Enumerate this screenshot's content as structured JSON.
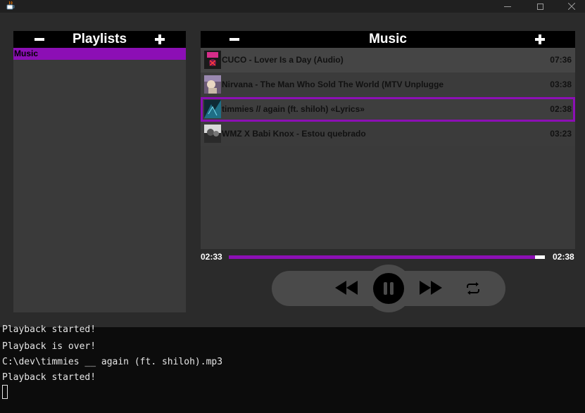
{
  "playlists": {
    "title": "Playlists",
    "items": [
      {
        "label": "Music",
        "selected": true
      }
    ]
  },
  "music": {
    "title": "Music",
    "tracks": [
      {
        "title": "CUCO - Lover Is a Day (Audio)",
        "duration": "07:36"
      },
      {
        "title": "Nirvana - The Man Who Sold The World (MTV Unplugge",
        "duration": "03:38"
      },
      {
        "title": "timmies // again (ft. shiloh) «Lyrics»",
        "duration": "02:38",
        "selected": true
      },
      {
        "title": "WMZ X Babi Knox - Estou quebrado",
        "duration": "03:23"
      }
    ]
  },
  "player": {
    "current_time": "02:33",
    "total_time": "02:38",
    "progress": 0.968
  },
  "console": {
    "lines": [
      "Playback started!",
      "Playback is over!",
      "C:\\dev\\timmies __ again (ft. shiloh).mp3",
      "Playback started!"
    ]
  },
  "theme": {
    "accent": "#8c0fb5",
    "panel": "#3a3a3a",
    "background": "#2b2b2b"
  },
  "icons": {
    "app": "java-cup-icon",
    "remove": "minus-icon",
    "add": "plus-icon",
    "previous": "rewind-icon",
    "pause": "pause-icon",
    "next": "fast-forward-icon",
    "repeat": "repeat-icon"
  }
}
